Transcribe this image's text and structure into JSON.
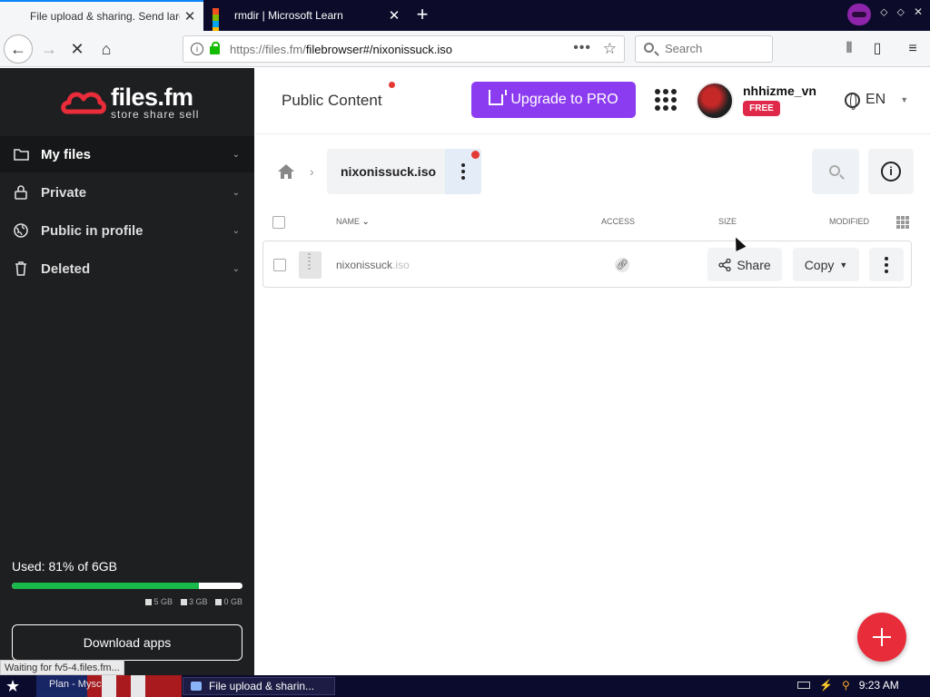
{
  "browser": {
    "tabs": [
      {
        "title": "File upload & sharing. Send large f",
        "active": true
      },
      {
        "title": "rmdir | Microsoft Learn",
        "active": false
      }
    ],
    "url_prefix": "https://files.fm/",
    "url_rest": "filebrowser#/nixonissuck.iso",
    "search_placeholder": "Search",
    "status_text": "Waiting for fv5-4.files.fm..."
  },
  "sidebar": {
    "brand_name": "files.fm",
    "brand_tagline": "store share sell",
    "items": [
      {
        "label": "My files",
        "icon": "folder-icon"
      },
      {
        "label": "Private",
        "icon": "lock-icon"
      },
      {
        "label": "Public in profile",
        "icon": "globe-icon"
      },
      {
        "label": "Deleted",
        "icon": "trash-icon"
      }
    ],
    "usage": {
      "label": "Used: 81% of 6GB",
      "percent": 81,
      "legend": [
        "5 GB",
        "3 GB",
        "0 GB"
      ]
    },
    "download_label": "Download apps"
  },
  "header": {
    "public_content": "Public Content",
    "upgrade_label": "Upgrade to PRO",
    "username": "nhhizme_vn",
    "plan_badge": "FREE",
    "language": "EN"
  },
  "main": {
    "breadcrumb_folder": "nixonissuck.iso",
    "columns": {
      "name": "NAME",
      "access": "ACCESS",
      "size": "SIZE",
      "modified": "MODIFIED"
    },
    "file": {
      "name": "nixonissuck",
      "ext": ".iso"
    },
    "share_label": "Share",
    "copy_label": "Copy"
  },
  "taskbar": {
    "flag_label": "Plan - Mysch...",
    "task_label": "File upload & sharin...",
    "clock": "9:23 AM"
  },
  "colors": {
    "accent_purple": "#8c3cf0",
    "brand_red": "#e82c3a",
    "usage_green": "#19b84a",
    "sidebar_bg": "#1e1f21"
  }
}
